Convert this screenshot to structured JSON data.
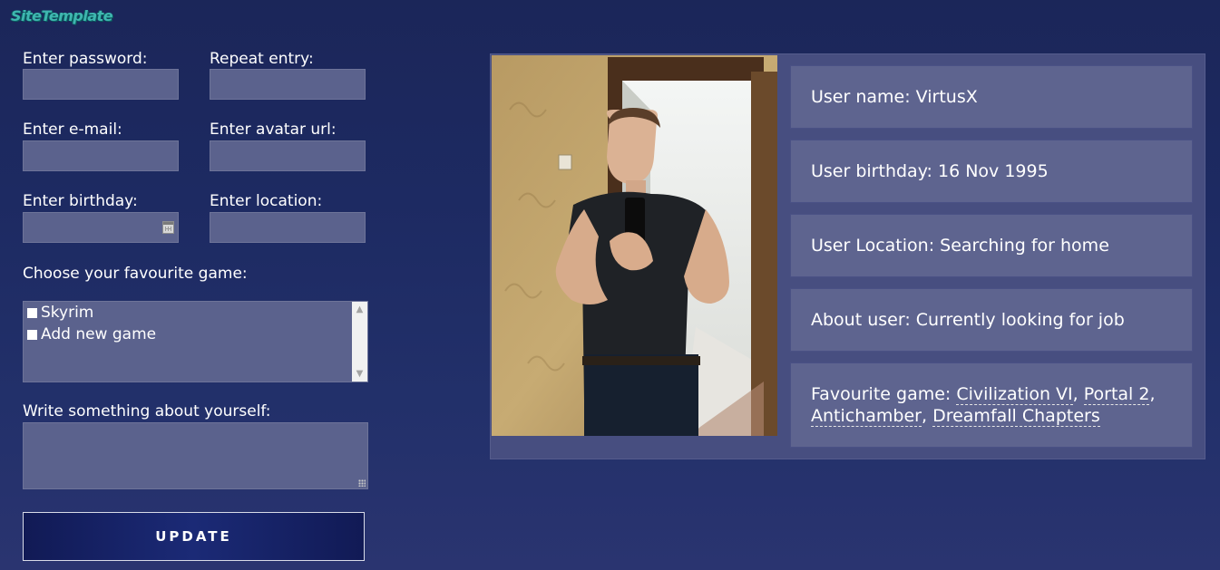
{
  "app": {
    "logo": "SiteTemplate"
  },
  "form": {
    "password_label": "Enter password:",
    "repeat_label": "Repeat entry:",
    "email_label": "Enter e-mail:",
    "avatar_label": "Enter avatar url:",
    "birthday_label": "Enter birthday:",
    "location_label": "Enter location:",
    "password_value": "",
    "repeat_value": "",
    "email_value": "",
    "avatar_value": "",
    "birthday_value": "",
    "location_value": "",
    "games_label": "Choose your favourite game:",
    "games_options": [
      "Skyrim",
      "Add new game"
    ],
    "about_label": "Write something about yourself:",
    "about_value": "",
    "update_label": "UPDATE"
  },
  "profile": {
    "name_label": "User name: ",
    "name": "VirtusX",
    "birthday_label": "User birthday: ",
    "birthday": "16 Nov 1995",
    "location_label": "User Location: ",
    "location": "Searching for home",
    "about_label": "About user: ",
    "about": "Currently looking for job",
    "games_label": "Favourite game: ",
    "games": [
      "Civilization VI",
      "Portal 2",
      "Antichamber",
      "Dreamfall Chapters"
    ]
  }
}
